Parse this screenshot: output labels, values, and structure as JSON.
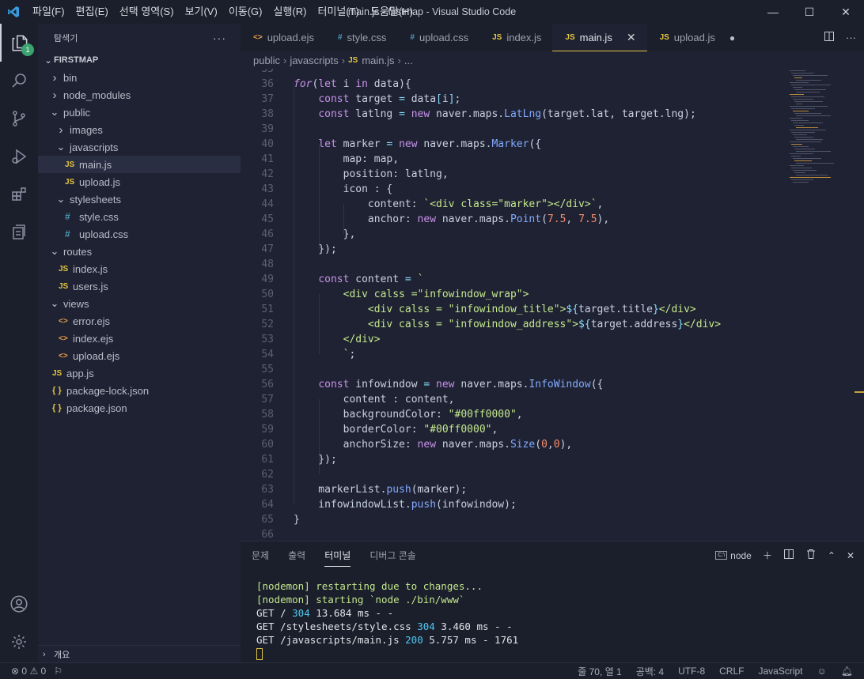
{
  "window": {
    "title": "main.js - firstmap - Visual Studio Code",
    "menu": [
      "파일(F)",
      "편집(E)",
      "선택 영역(S)",
      "보기(V)",
      "이동(G)",
      "실행(R)",
      "터미널(T)",
      "도움말(H)"
    ],
    "controls": {
      "minimize": "—",
      "maximize": "☐",
      "close": "✕"
    }
  },
  "activity": {
    "items": [
      "explorer-icon",
      "search-icon",
      "source-control-icon",
      "run-debug-icon",
      "extensions-icon",
      "remote-icon"
    ],
    "explorer_badge": "1",
    "bottom": [
      "account-icon",
      "settings-gear-icon"
    ]
  },
  "sidebar": {
    "title": "탐색기",
    "more": "···",
    "root": "FIRSTMAP",
    "tree": [
      {
        "label": "bin",
        "type": "folder",
        "depth": 1,
        "open": false
      },
      {
        "label": "node_modules",
        "type": "folder",
        "depth": 1,
        "open": false
      },
      {
        "label": "public",
        "type": "folder",
        "depth": 1,
        "open": true
      },
      {
        "label": "images",
        "type": "folder",
        "depth": 2,
        "open": false
      },
      {
        "label": "javascripts",
        "type": "folder",
        "depth": 2,
        "open": true
      },
      {
        "label": "main.js",
        "type": "js",
        "depth": 3,
        "selected": true
      },
      {
        "label": "upload.js",
        "type": "js",
        "depth": 3
      },
      {
        "label": "stylesheets",
        "type": "folder",
        "depth": 2,
        "open": true
      },
      {
        "label": "style.css",
        "type": "css",
        "depth": 3
      },
      {
        "label": "upload.css",
        "type": "css",
        "depth": 3
      },
      {
        "label": "routes",
        "type": "folder",
        "depth": 1,
        "open": true
      },
      {
        "label": "index.js",
        "type": "js",
        "depth": 2
      },
      {
        "label": "users.js",
        "type": "js",
        "depth": 2
      },
      {
        "label": "views",
        "type": "folder",
        "depth": 1,
        "open": true
      },
      {
        "label": "error.ejs",
        "type": "ejs",
        "depth": 2
      },
      {
        "label": "index.ejs",
        "type": "ejs",
        "depth": 2
      },
      {
        "label": "upload.ejs",
        "type": "ejs",
        "depth": 2
      },
      {
        "label": "app.js",
        "type": "js",
        "depth": 1
      },
      {
        "label": "package-lock.json",
        "type": "json",
        "depth": 1
      },
      {
        "label": "package.json",
        "type": "json",
        "depth": 1
      }
    ],
    "outline": "개요"
  },
  "tabs": [
    {
      "label": "upload.ejs",
      "icon": "<>",
      "kind": "ejs"
    },
    {
      "label": "style.css",
      "icon": "#",
      "kind": "css"
    },
    {
      "label": "upload.css",
      "icon": "#",
      "kind": "css"
    },
    {
      "label": "index.js",
      "icon": "JS",
      "kind": "js"
    },
    {
      "label": "main.js",
      "icon": "JS",
      "kind": "js",
      "active": true
    },
    {
      "label": "upload.js",
      "icon": "JS",
      "kind": "js",
      "dirty": true
    }
  ],
  "breadcrumb": [
    "public",
    "javascripts",
    "main.js",
    "..."
  ],
  "code": {
    "first_line": 35,
    "lines": [
      [],
      [
        [
          "kf",
          "for"
        ],
        [
          "v",
          "("
        ],
        [
          "k",
          "let"
        ],
        [
          "v",
          " i "
        ],
        [
          "k",
          "in"
        ],
        [
          "v",
          " data){"
        ]
      ],
      [
        [
          "v",
          "    "
        ],
        [
          "k",
          "const"
        ],
        [
          "v",
          " target "
        ],
        [
          "o",
          "="
        ],
        [
          "v",
          " data"
        ],
        [
          "o",
          "["
        ],
        [
          "v",
          "i"
        ],
        [
          "o",
          "]"
        ],
        [
          "v",
          ";"
        ]
      ],
      [
        [
          "v",
          "    "
        ],
        [
          "k",
          "const"
        ],
        [
          "v",
          " latlng "
        ],
        [
          "o",
          "="
        ],
        [
          "v",
          " "
        ],
        [
          "k",
          "new"
        ],
        [
          "v",
          " naver.maps."
        ],
        [
          "f",
          "LatLng"
        ],
        [
          "v",
          "(target.lat, target.lng);"
        ]
      ],
      [],
      [
        [
          "v",
          "    "
        ],
        [
          "k",
          "let"
        ],
        [
          "v",
          " marker "
        ],
        [
          "o",
          "="
        ],
        [
          "v",
          " "
        ],
        [
          "k",
          "new"
        ],
        [
          "v",
          " naver.maps."
        ],
        [
          "f",
          "Marker"
        ],
        [
          "v",
          "({"
        ]
      ],
      [
        [
          "v",
          "        map: map,"
        ]
      ],
      [
        [
          "v",
          "        position: latlng,"
        ]
      ],
      [
        [
          "v",
          "        icon : {"
        ]
      ],
      [
        [
          "v",
          "            content: "
        ],
        [
          "s",
          "`"
        ],
        [
          "tg",
          "<div class="
        ],
        [
          "s",
          "\"marker\""
        ],
        [
          "tg",
          "></div>"
        ],
        [
          "s",
          "`"
        ],
        [
          "v",
          ","
        ]
      ],
      [
        [
          "v",
          "            anchor: "
        ],
        [
          "k",
          "new"
        ],
        [
          "v",
          " naver.maps."
        ],
        [
          "f",
          "Point"
        ],
        [
          "v",
          "("
        ],
        [
          "n",
          "7.5"
        ],
        [
          "v",
          ", "
        ],
        [
          "n",
          "7.5"
        ],
        [
          "v",
          "),"
        ]
      ],
      [
        [
          "v",
          "        },"
        ]
      ],
      [
        [
          "v",
          "    });"
        ]
      ],
      [],
      [
        [
          "v",
          "    "
        ],
        [
          "k",
          "const"
        ],
        [
          "v",
          " content "
        ],
        [
          "o",
          "="
        ],
        [
          "v",
          " "
        ],
        [
          "s",
          "`"
        ]
      ],
      [
        [
          "tg",
          "        <div calss ="
        ],
        [
          "s",
          "\"infowindow_wrap\""
        ],
        [
          "tg",
          ">"
        ]
      ],
      [
        [
          "tg",
          "            <div calss = "
        ],
        [
          "s",
          "\"infowindow_title\""
        ],
        [
          "tg",
          ">"
        ],
        [
          "o",
          "${"
        ],
        [
          "v",
          "target.title"
        ],
        [
          "o",
          "}"
        ],
        [
          "tg",
          "</div>"
        ]
      ],
      [
        [
          "tg",
          "            <div calss = "
        ],
        [
          "s",
          "\"infowindow_address\""
        ],
        [
          "tg",
          ">"
        ],
        [
          "o",
          "${"
        ],
        [
          "v",
          "target.address"
        ],
        [
          "o",
          "}"
        ],
        [
          "tg",
          "</div>"
        ]
      ],
      [
        [
          "tg",
          "        </div>"
        ]
      ],
      [
        [
          "s",
          "        `"
        ],
        [
          "v",
          ";"
        ]
      ],
      [],
      [
        [
          "v",
          "    "
        ],
        [
          "k",
          "const"
        ],
        [
          "v",
          " infowindow "
        ],
        [
          "o",
          "="
        ],
        [
          "v",
          " "
        ],
        [
          "k",
          "new"
        ],
        [
          "v",
          " naver.maps."
        ],
        [
          "f",
          "InfoWindow"
        ],
        [
          "v",
          "({"
        ]
      ],
      [
        [
          "v",
          "        content : content,"
        ]
      ],
      [
        [
          "v",
          "        backgroundColor: "
        ],
        [
          "s",
          "\"#00ff0000\""
        ],
        [
          "v",
          ","
        ]
      ],
      [
        [
          "v",
          "        borderColor: "
        ],
        [
          "s",
          "\"#00ff0000\""
        ],
        [
          "v",
          ","
        ]
      ],
      [
        [
          "v",
          "        anchorSize: "
        ],
        [
          "k",
          "new"
        ],
        [
          "v",
          " naver.maps."
        ],
        [
          "f",
          "Size"
        ],
        [
          "v",
          "("
        ],
        [
          "n",
          "0"
        ],
        [
          "v",
          ","
        ],
        [
          "n",
          "0"
        ],
        [
          "v",
          "),"
        ]
      ],
      [
        [
          "v",
          "    });"
        ]
      ],
      [],
      [
        [
          "v",
          "    markerList."
        ],
        [
          "f",
          "push"
        ],
        [
          "v",
          "(marker);"
        ]
      ],
      [
        [
          "v",
          "    infowindowList."
        ],
        [
          "f",
          "push"
        ],
        [
          "v",
          "(infowindow);"
        ]
      ],
      [
        [
          "v",
          "}"
        ]
      ],
      []
    ]
  },
  "panel": {
    "tabs": [
      "문제",
      "출력",
      "터미널",
      "디버그 콘솔"
    ],
    "active_tab": "터미널",
    "terminal_name": "node",
    "terminal_lines": [
      {
        "text": "[nodemon] restarting due to changes...",
        "color": "green"
      },
      {
        "text": "[nodemon] starting `node ./bin/www`",
        "color": "green"
      },
      {
        "text": "GET / 304 13.684 ms - -",
        "status": "304"
      },
      {
        "text": "GET /stylesheets/style.css 304 3.460 ms - -",
        "status": "304"
      },
      {
        "text": "GET /javascripts/main.js 200 5.757 ms - 1761",
        "status": "200"
      }
    ]
  },
  "statusbar": {
    "errors": "0",
    "warnings": "0",
    "position": "줄 70, 열 1",
    "spaces": "공백: 4",
    "encoding": "UTF-8",
    "eol": "CRLF",
    "language": "JavaScript"
  },
  "colors": {
    "background": "#1f2232",
    "accent": "#e2c541",
    "keyword": "#c792ea",
    "function": "#82aaff",
    "string": "#c3e88d"
  }
}
